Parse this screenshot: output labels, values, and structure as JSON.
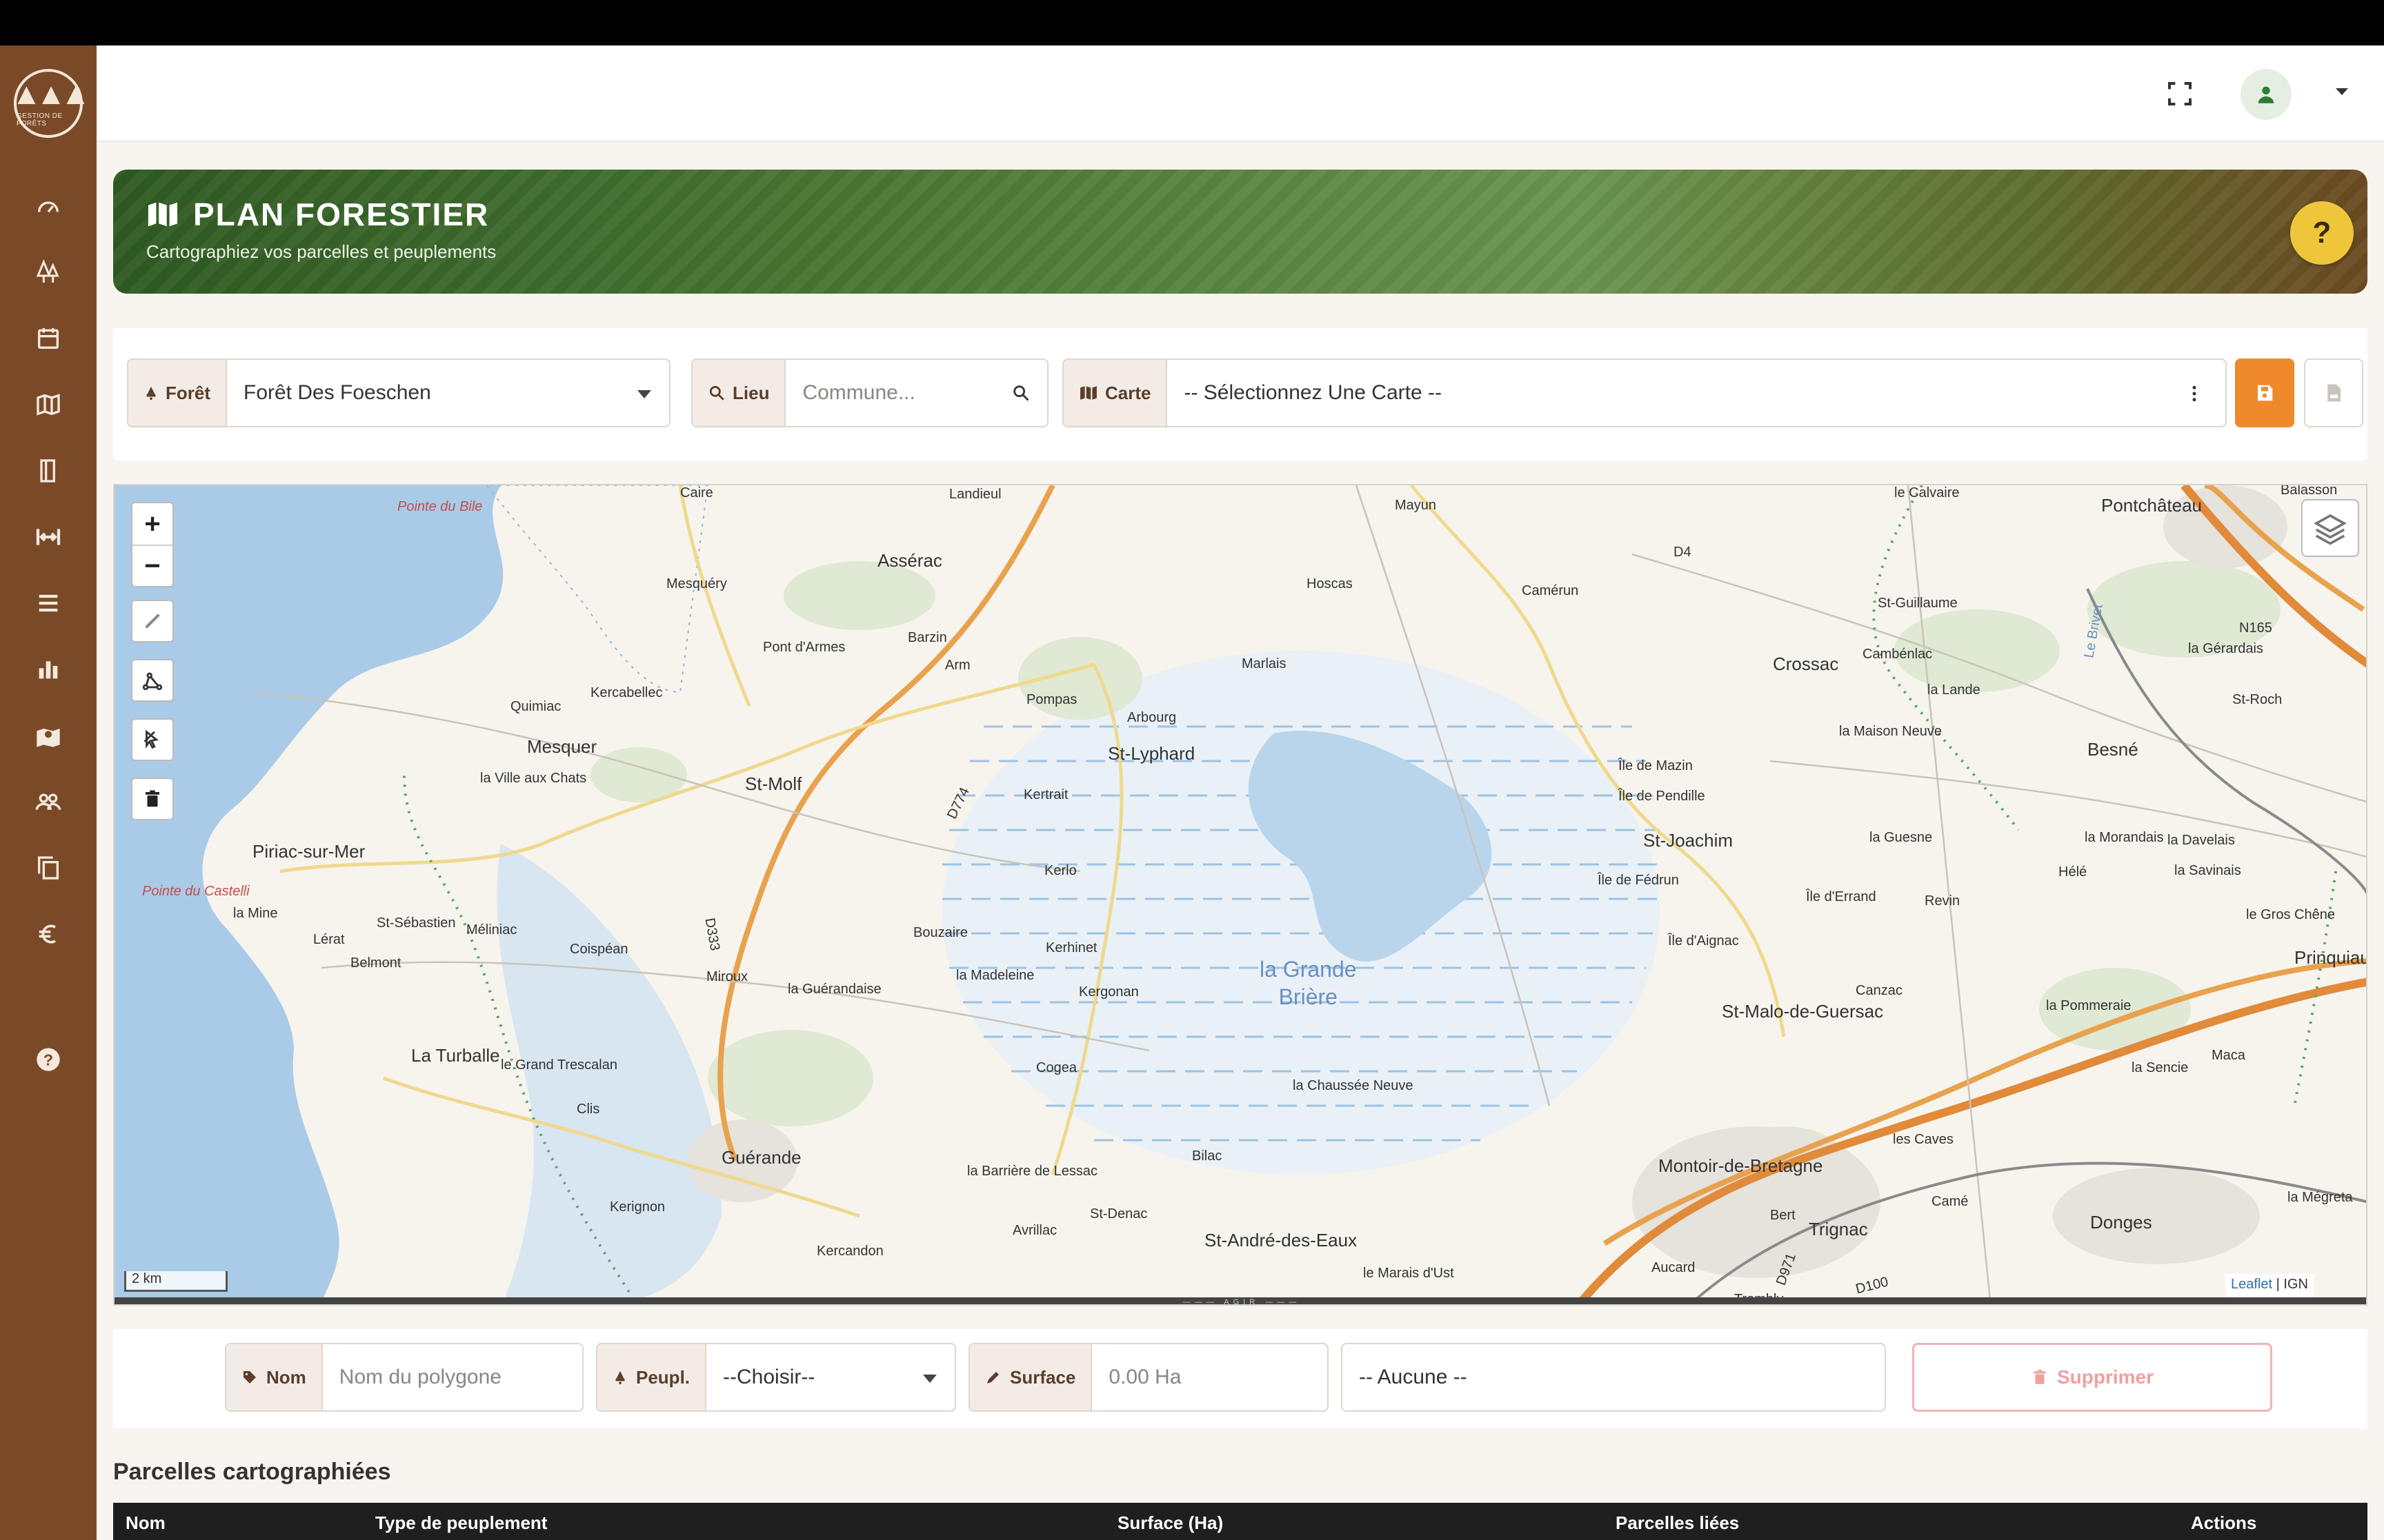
{
  "sidebar": {
    "logo_text": "GESTION DE FORÊTS",
    "items": [
      {
        "icon": "dashboard-icon"
      },
      {
        "icon": "trees-icon"
      },
      {
        "icon": "calendar-icon"
      },
      {
        "icon": "map-icon"
      },
      {
        "icon": "book-icon"
      },
      {
        "icon": "arrows-horizontal-icon"
      },
      {
        "icon": "list-icon"
      },
      {
        "icon": "chart-icon"
      },
      {
        "icon": "map-marker-icon"
      },
      {
        "icon": "users-icon"
      },
      {
        "icon": "copy-icon"
      },
      {
        "icon": "euro-icon"
      },
      {
        "icon": "help-icon"
      }
    ]
  },
  "banner": {
    "title": "PLAN FORESTIER",
    "subtitle": "Cartographiez vos parcelles et peuplements",
    "help": "?"
  },
  "filters": {
    "foret_label": "Forêt",
    "foret_value": "Forêt Des Foeschen",
    "lieu_label": "Lieu",
    "lieu_placeholder": "Commune...",
    "carte_label": "Carte",
    "carte_value": "-- Sélectionnez Une Carte --"
  },
  "map": {
    "scale": "2 km",
    "attribution_leaflet": "Leaflet",
    "attribution_ign": "| IGN",
    "bar_label": "——— AGIR ———",
    "labels": [
      {
        "t": "Pointe du Bile",
        "c": "red"
      },
      {
        "t": "Caire"
      },
      {
        "t": "Landieul"
      },
      {
        "t": "Mayun"
      },
      {
        "t": "le Calvaire"
      },
      {
        "t": "Pontchâteau",
        "c": "big"
      },
      {
        "t": "Balasson"
      },
      {
        "t": "Mesquéry"
      },
      {
        "t": "Assérac",
        "c": "big"
      },
      {
        "t": "Hoscas"
      },
      {
        "t": "Camérun"
      },
      {
        "t": "D4"
      },
      {
        "t": "St-Guillaume"
      },
      {
        "t": "N165"
      },
      {
        "t": "Pont d'Armes"
      },
      {
        "t": "Barzin"
      },
      {
        "t": "Arm"
      },
      {
        "t": "Marlais"
      },
      {
        "t": "Crossac",
        "c": "big"
      },
      {
        "t": "Cambénlac"
      },
      {
        "t": "la Gérardais"
      },
      {
        "t": "Kercabellec"
      },
      {
        "t": "Quimiac"
      },
      {
        "t": "Pompas"
      },
      {
        "t": "Arbourg"
      },
      {
        "t": "la Lande"
      },
      {
        "t": "Le Brivet"
      },
      {
        "t": "St-Roch"
      },
      {
        "t": "Mesquer",
        "c": "big"
      },
      {
        "t": "St-Lyphard",
        "c": "big"
      },
      {
        "t": "la Maison Neuve"
      },
      {
        "t": "Besné",
        "c": "big"
      },
      {
        "t": "la Ville aux Chats"
      },
      {
        "t": "St-Molf",
        "c": "big"
      },
      {
        "t": "Kertrait"
      },
      {
        "t": "Île de Mazin"
      },
      {
        "t": "Île de Pendille"
      },
      {
        "t": "D774"
      },
      {
        "t": "Piriac-sur-Mer",
        "c": "big"
      },
      {
        "t": "St-Joachim",
        "c": "big"
      },
      {
        "t": "la Guesne"
      },
      {
        "t": "la Morandais"
      },
      {
        "t": "la Davelais"
      },
      {
        "t": "Pointe du Castelli",
        "c": "red"
      },
      {
        "t": "Kerlo"
      },
      {
        "t": "Île de Fédrun"
      },
      {
        "t": "Île d'Errand"
      },
      {
        "t": "la Savinais"
      },
      {
        "t": "Hélé"
      },
      {
        "t": "la Mine"
      },
      {
        "t": "St-Sébastien"
      },
      {
        "t": "Méliniac"
      },
      {
        "t": "Lérat"
      },
      {
        "t": "Bouzaire"
      },
      {
        "t": "Revin"
      },
      {
        "t": "le Gros Chêne"
      },
      {
        "t": "Coispéan"
      },
      {
        "t": "D333"
      },
      {
        "t": "Kerhinet"
      },
      {
        "t": "Île d'Aignac"
      },
      {
        "t": "Prinquiau",
        "c": "big"
      },
      {
        "t": "Belmont"
      },
      {
        "t": "Miroux"
      },
      {
        "t": "la Madeleine"
      },
      {
        "t": "la Guérandaise"
      },
      {
        "t": "Kergonan"
      },
      {
        "t": "Canzac"
      },
      {
        "t": "la Pommeraie"
      },
      {
        "t": "St-Malo-de-Guersac",
        "c": "big"
      },
      {
        "t": "La Turballe",
        "c": "big"
      },
      {
        "t": "le Grand Trescalan"
      },
      {
        "t": "Cogea"
      },
      {
        "t": "la Chaussée Neuve"
      },
      {
        "t": "Maca"
      },
      {
        "t": "la Sencie"
      },
      {
        "t": "Clis"
      },
      {
        "t": "Bilac"
      },
      {
        "t": "les Caves"
      },
      {
        "t": "Guérande",
        "c": "big"
      },
      {
        "t": "la Barrière de Lessac"
      },
      {
        "t": "Montoir-de-Bretagne",
        "c": "big"
      },
      {
        "t": "Kerignon"
      },
      {
        "t": "St-Denac"
      },
      {
        "t": "Camé"
      },
      {
        "t": "la Mégreta"
      },
      {
        "t": "Avrillac"
      },
      {
        "t": "Bert"
      },
      {
        "t": "Trignac",
        "c": "big"
      },
      {
        "t": "Donges",
        "c": "big"
      },
      {
        "t": "Kercandon"
      },
      {
        "t": "St-André-des-Eaux",
        "c": "big"
      },
      {
        "t": "le Marais d'Ust"
      },
      {
        "t": "Aucard"
      },
      {
        "t": "D971"
      },
      {
        "t": "D100"
      },
      {
        "t": "Trembly"
      }
    ],
    "region_label_1": "la Grande",
    "region_label_2": "Brière"
  },
  "polygon": {
    "nom_label": "Nom",
    "nom_placeholder": "Nom du polygone",
    "peupl_label": "Peupl.",
    "peupl_value": "--Choisir--",
    "surface_label": "Surface",
    "surface_placeholder": "0.00 Ha",
    "parcelle_value": "-- Aucune --",
    "delete_label": "Supprimer"
  },
  "parcelles": {
    "title": "Parcelles cartographiées",
    "columns": [
      "Nom",
      "Type de peuplement",
      "Surface (Ha)",
      "Parcelles liées",
      "Actions"
    ]
  },
  "colors": {
    "sidebar": "#7a4a28",
    "accent_orange": "#ee8a2c",
    "help_yellow": "#efc63a"
  }
}
